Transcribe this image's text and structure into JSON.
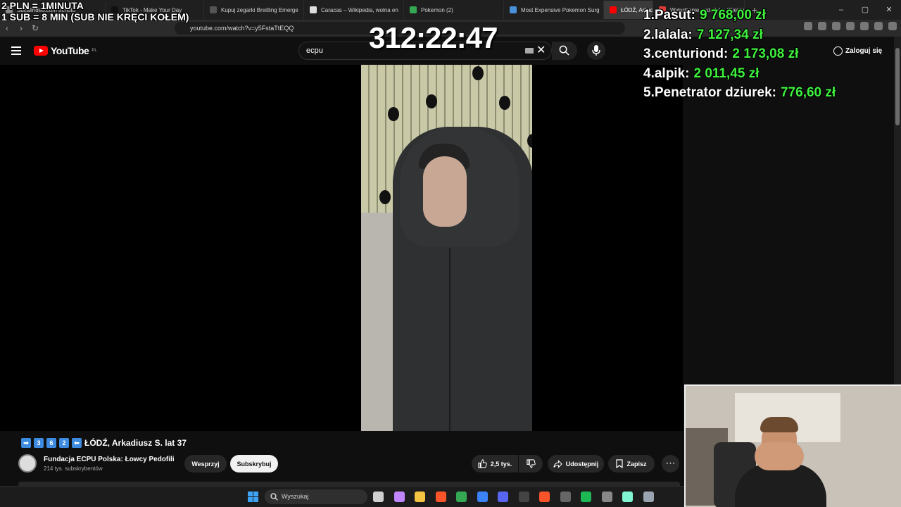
{
  "browser": {
    "tabs": [
      {
        "label": "Sucalindeo.com ocnoto",
        "color": "#8a8a8a"
      },
      {
        "label": "TikTok - Make Your Day",
        "color": "#111111"
      },
      {
        "label": "Kupuj zegarki Breitling Emerge",
        "color": "#555555"
      },
      {
        "label": "Caracas – Wikipedia, wolna en",
        "color": "#dddddd"
      },
      {
        "label": "Pokemon (2)",
        "color": "#34a853"
      },
      {
        "label": "Most Expensive Pokemon Surg",
        "color": "#4a90d9"
      },
      {
        "label": "ŁÓDŹ, Arkad",
        "color": "#ff0000"
      },
      {
        "label": "Wyłudzenie podatków (Giełda",
        "color": "#e33a3a"
      }
    ],
    "new_tab": "+",
    "window_controls": [
      "–",
      "▢",
      "✕"
    ],
    "url": "youtube.com/watch?v=y5FstaTtEQQ"
  },
  "youtube": {
    "logo_text": "YouTube",
    "region": "PL",
    "search_value": "ecpu",
    "sign_in": "Zaloguj się"
  },
  "video": {
    "title_prefix_keys": [
      "➡",
      "3",
      "6",
      "2",
      "⬅"
    ],
    "title": "ŁÓDŹ, Arkadiusz S. lat 37",
    "channel": "Fundacja ECPU Polska: Łowcy Pedofili",
    "subscribers": "214 tys. subskrybentów",
    "support_label": "Wesprzyj",
    "subscribe_label": "Subskrybuj",
    "likes": "2,5 tys.",
    "share_label": "Udostępnij",
    "save_label": "Zapisz",
    "more_label": "⋯"
  },
  "overlay": {
    "line1": "2 PLN =  1MINUTA",
    "line2": "1 SUB = 8 MIN (SUB NIE KRĘCI KOŁEM)",
    "timer": "312:22:47",
    "leaderboard": [
      {
        "rank": "1.",
        "name": "Pasut:",
        "amount": "9 768,00 zł"
      },
      {
        "rank": "2.",
        "name": "lalala:",
        "amount": "7 127,34 zł"
      },
      {
        "rank": "3.",
        "name": "centuriond:",
        "amount": "2 173,08 zł"
      },
      {
        "rank": "4.",
        "name": "alpik:",
        "amount": "2 011,45 zł"
      },
      {
        "rank": "5.",
        "name": "Penetrator dziurek:",
        "amount": "776,60 zł"
      }
    ]
  },
  "taskbar": {
    "search_placeholder": "Wyszukaj",
    "icons": [
      {
        "name": "task-view-icon",
        "color": "#cfcfcf"
      },
      {
        "name": "copilot-icon",
        "color": "#c084fc"
      },
      {
        "name": "file-explorer-icon",
        "color": "#f5c542"
      },
      {
        "name": "brave-icon",
        "color": "#fb542b"
      },
      {
        "name": "chrome-icon",
        "color": "#34a853"
      },
      {
        "name": "store-icon",
        "color": "#3b82f6"
      },
      {
        "name": "discord-icon",
        "color": "#5865f2"
      },
      {
        "name": "obs-icon",
        "color": "#444444"
      },
      {
        "name": "brave-active-icon",
        "color": "#fb542b"
      },
      {
        "name": "app-icon",
        "color": "#666666"
      },
      {
        "name": "spotify-icon",
        "color": "#1db954"
      },
      {
        "name": "calculator-icon",
        "color": "#888888"
      },
      {
        "name": "streamlabs-icon",
        "color": "#80f5d2"
      },
      {
        "name": "settings-icon",
        "color": "#9aa4b1"
      }
    ]
  },
  "colors": {
    "accent_red": "#ff0000",
    "leaderboard_amount": "#3ef23e"
  }
}
